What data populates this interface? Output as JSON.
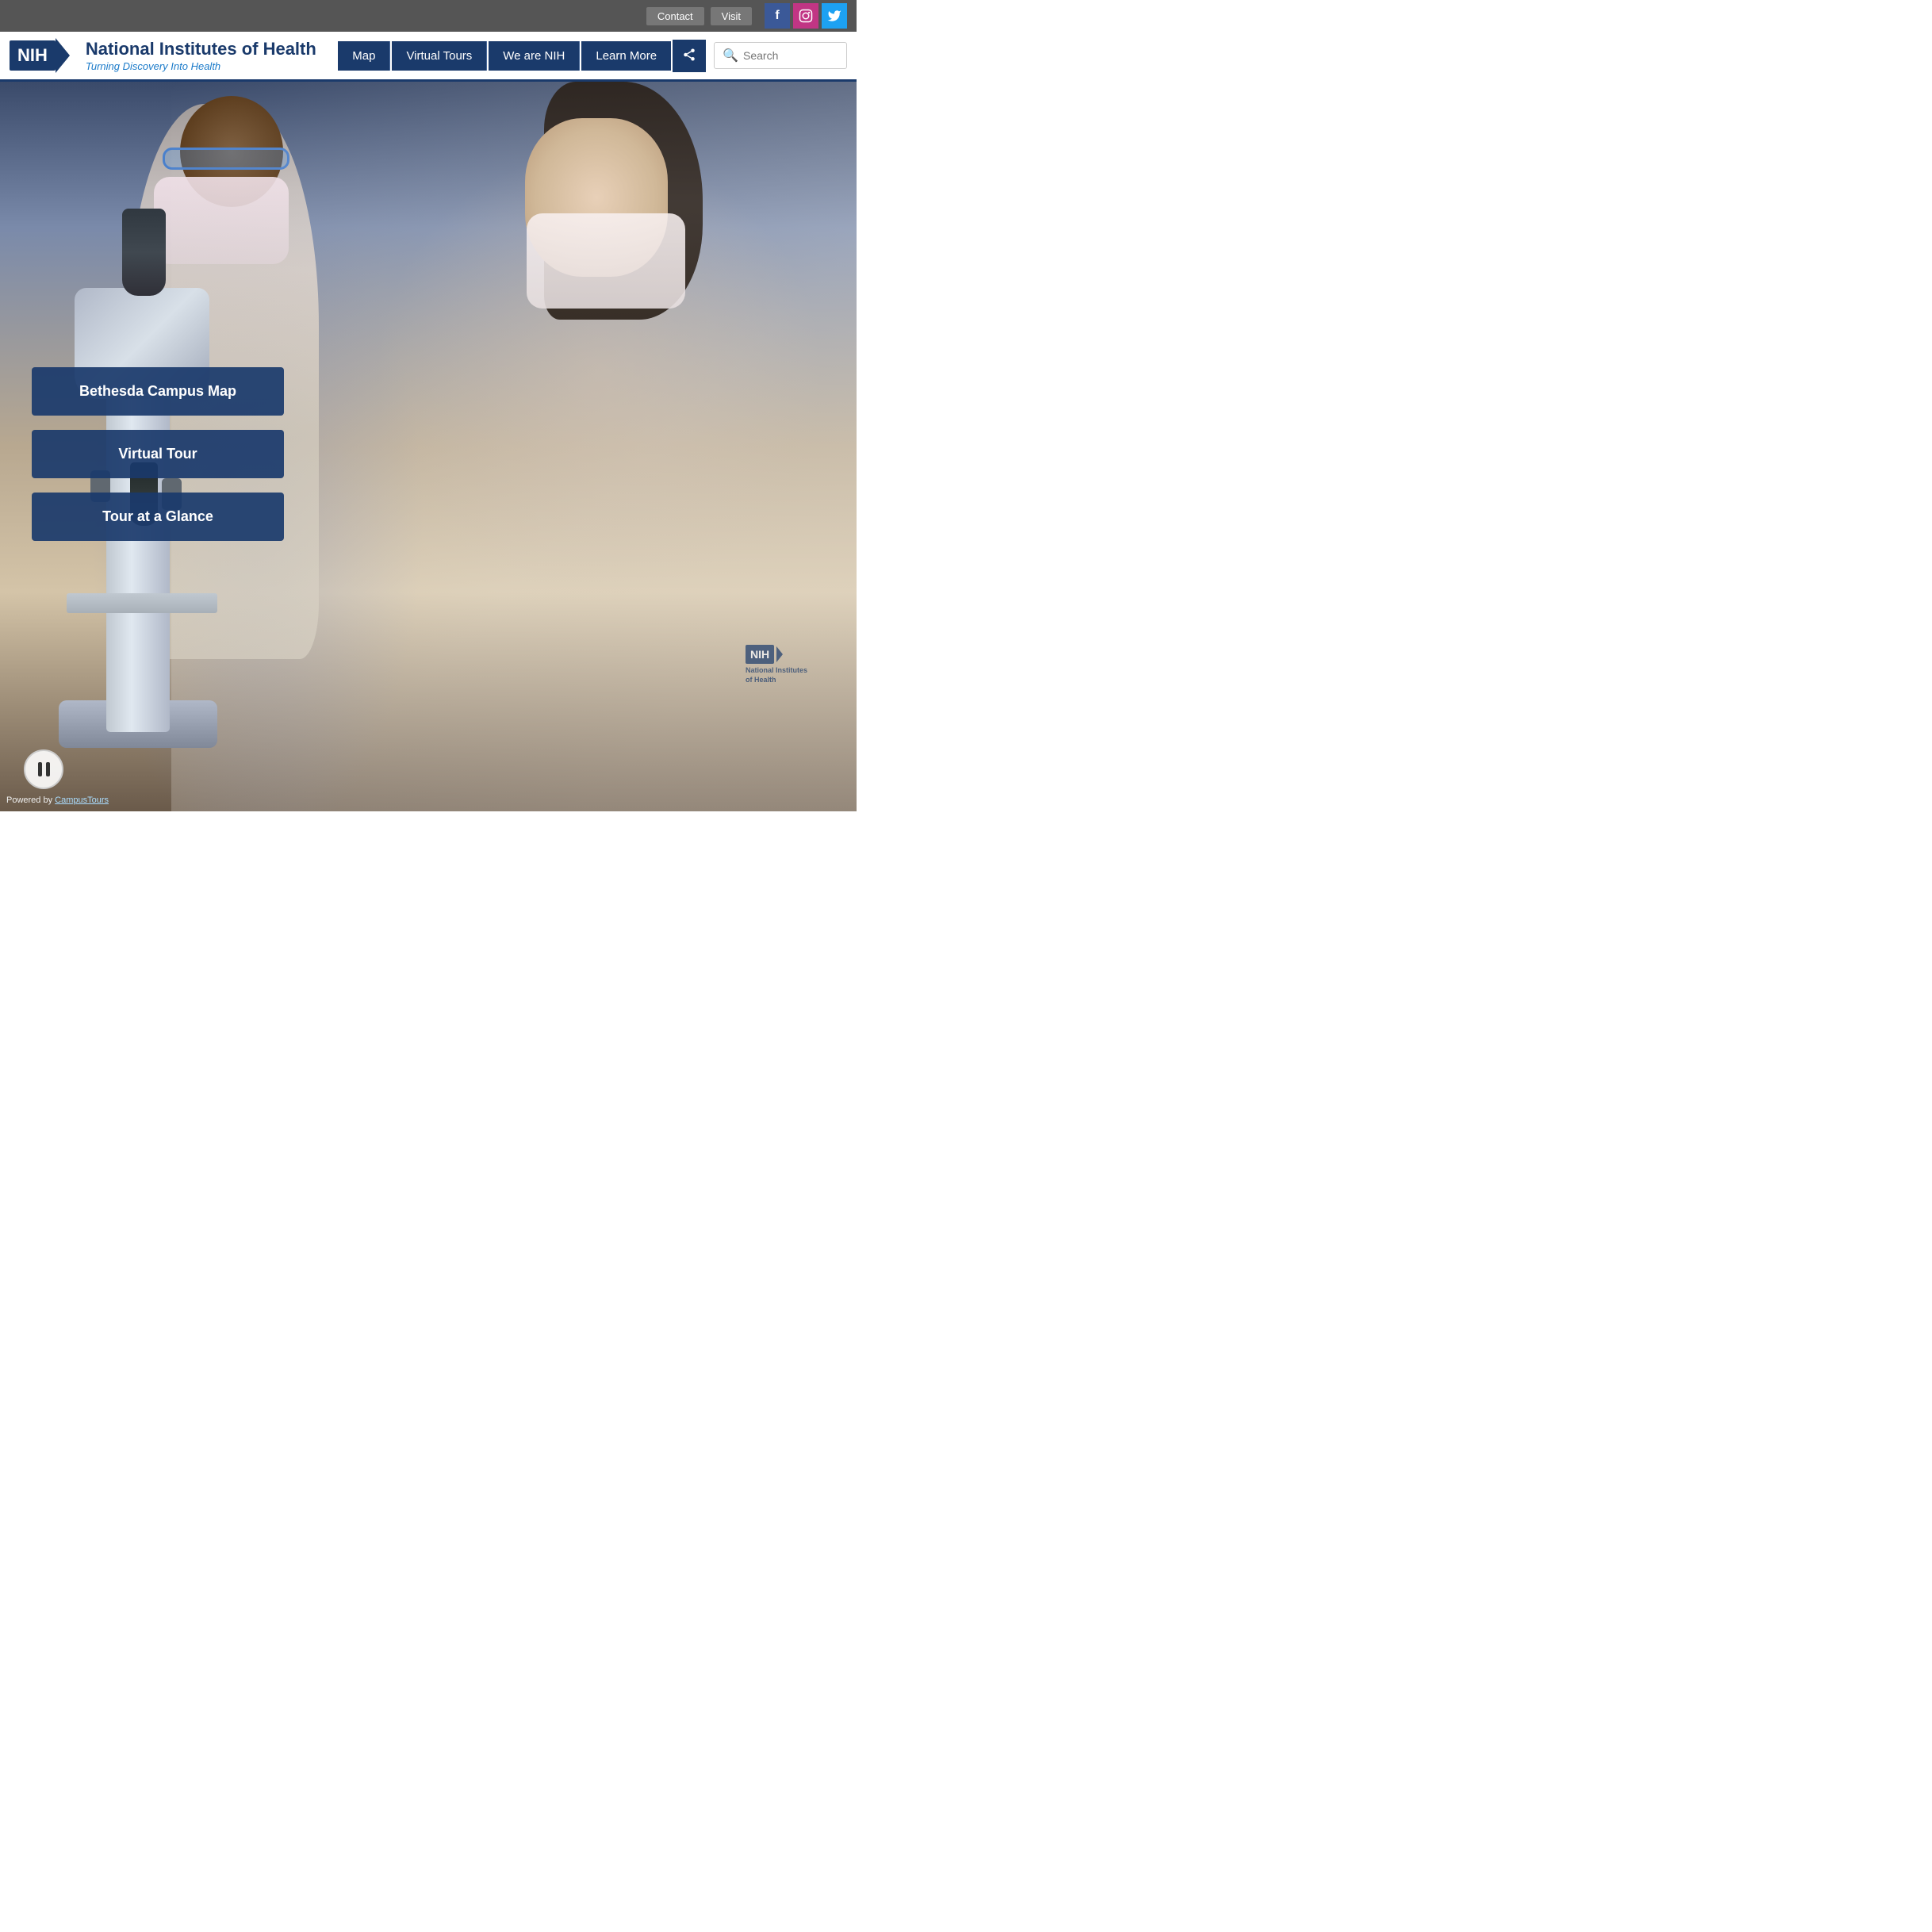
{
  "topbar": {
    "contact_label": "Contact",
    "visit_label": "Visit"
  },
  "social": {
    "facebook_label": "f",
    "instagram_label": "📷",
    "twitter_label": "🐦"
  },
  "header": {
    "org_abbr": "NIH",
    "org_name": "National Institutes of Health",
    "org_tagline": "Turning Discovery Into Health"
  },
  "nav": {
    "items": [
      {
        "id": "map",
        "label": "Map"
      },
      {
        "id": "virtual-tours",
        "label": "Virtual Tours"
      },
      {
        "id": "we-are-nih",
        "label": "We are NIH"
      },
      {
        "id": "learn-more",
        "label": "Learn More"
      }
    ],
    "share_icon": "⊕",
    "search_placeholder": "Search"
  },
  "hero": {
    "cta_buttons": [
      {
        "id": "bethesda-campus-map",
        "label": "Bethesda Campus Map"
      },
      {
        "id": "virtual-tour",
        "label": "Virtual Tour"
      },
      {
        "id": "tour-at-a-glance",
        "label": "Tour at a Glance"
      }
    ]
  },
  "footer": {
    "powered_by": "Powered by",
    "campus_tours_link": "CampusTours"
  }
}
